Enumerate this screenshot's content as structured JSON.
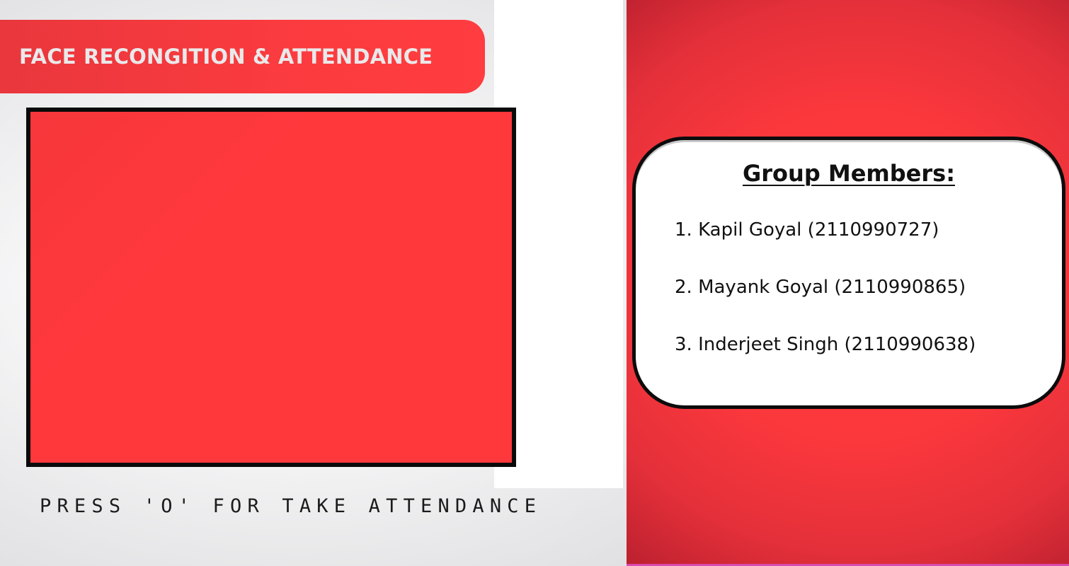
{
  "app": {
    "title": "FACE RECONGITION & ATTENDANCE",
    "hint": "PRESS 'O' FOR TAKE ATTENDANCE"
  },
  "members": {
    "heading": "Group Members:",
    "items": [
      {
        "label": "1. Kapil Goyal (2110990727)"
      },
      {
        "label": "2. Mayank Goyal (2110990865)"
      },
      {
        "label": "3. Inderjeet Singh (2110990638)"
      }
    ]
  },
  "colors": {
    "accent_red": "#ff383c",
    "frame_border": "#0a0a0a",
    "panel_bg": "#f4f4f5",
    "card_bg": "#ffffff"
  }
}
